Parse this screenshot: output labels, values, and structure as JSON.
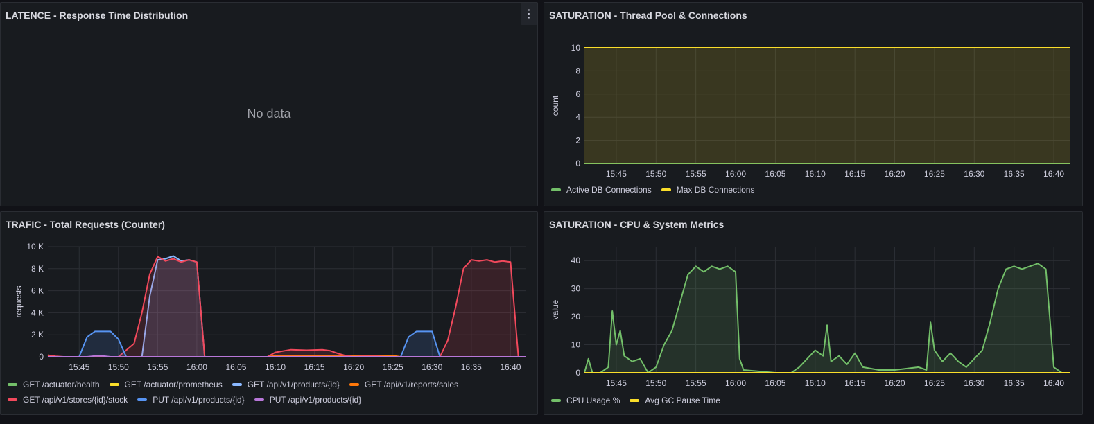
{
  "panels": {
    "latency": {
      "title": "LATENCE - Response Time Distribution",
      "menu_icon": "⋮",
      "no_data": "No data"
    },
    "threads": {
      "title": "SATURATION - Thread Pool & Connections",
      "legend": [
        {
          "label": "Active DB Connections",
          "color": "#73bf69"
        },
        {
          "label": "Max DB Connections",
          "color": "#fade2a"
        }
      ]
    },
    "traffic": {
      "title": "TRAFIC - Total Requests (Counter)",
      "legend": [
        {
          "label": "GET /actuator/health",
          "color": "#73bf69"
        },
        {
          "label": "GET /actuator/prometheus",
          "color": "#fade2a"
        },
        {
          "label": "GET /api/v1/products/{id}",
          "color": "#8ab8ff"
        },
        {
          "label": "GET /api/v1/reports/sales",
          "color": "#ff780a"
        },
        {
          "label": "GET /api/v1/stores/{id}/stock",
          "color": "#f2495c"
        },
        {
          "label": "PUT /api/v1/products/{id}",
          "color": "#5794f2"
        },
        {
          "label": "PUT /api/v1/products/{id}",
          "color": "#b877d9"
        }
      ]
    },
    "cpu": {
      "title": "SATURATION - CPU & System Metrics",
      "legend": [
        {
          "label": "CPU Usage %",
          "color": "#73bf69"
        },
        {
          "label": "Avg GC Pause Time",
          "color": "#fade2a"
        }
      ]
    }
  },
  "chart_data": [
    {
      "id": "threads",
      "type": "area",
      "ylabel": "count",
      "ylim": [
        0,
        10
      ],
      "xlim": [
        "15:41",
        "16:42"
      ],
      "y_ticks": [
        "0",
        "2",
        "4",
        "6",
        "8",
        "10"
      ],
      "x_ticks": [
        "15:45",
        "15:50",
        "15:55",
        "16:00",
        "16:05",
        "16:10",
        "16:15",
        "16:20",
        "16:25",
        "16:30",
        "16:35",
        "16:40"
      ],
      "grid": true,
      "series": [
        {
          "name": "Active DB Connections",
          "color": "#73bf69",
          "x": [
            "15:41",
            "16:42"
          ],
          "values": [
            0,
            0
          ]
        },
        {
          "name": "Max DB Connections",
          "color": "#fade2a",
          "x": [
            "15:41",
            "16:42"
          ],
          "values": [
            10,
            10
          ]
        }
      ]
    },
    {
      "id": "traffic",
      "type": "area",
      "ylabel": "requests",
      "ylim": [
        0,
        10000
      ],
      "xlim": [
        "15:41",
        "16:42"
      ],
      "y_ticks": [
        "0",
        "2 K",
        "4 K",
        "6 K",
        "8 K",
        "10 K"
      ],
      "x_ticks": [
        "15:45",
        "15:50",
        "15:55",
        "16:00",
        "16:05",
        "16:10",
        "16:15",
        "16:20",
        "16:25",
        "16:30",
        "16:35",
        "16:40"
      ],
      "grid": true,
      "series": [
        {
          "name": "GET /actuator/health",
          "color": "#73bf69",
          "x": [
            "15:41",
            "16:42"
          ],
          "values": [
            0,
            0
          ]
        },
        {
          "name": "GET /actuator/prometheus",
          "color": "#fade2a",
          "x": [
            "16:08",
            "16:42"
          ],
          "values": [
            0,
            0
          ]
        },
        {
          "name": "GET /api/v1/products/{id}",
          "color": "#8ab8ff",
          "x": [
            "15:41",
            "15:53",
            "15:54",
            "15:55",
            "15:56",
            "15:57",
            "15:58",
            "15:59",
            "16:00",
            "16:01",
            "16:42"
          ],
          "values": [
            0,
            0,
            5500,
            8800,
            8900,
            9150,
            8700,
            8800,
            8600,
            0,
            0
          ]
        },
        {
          "name": "GET /api/v1/reports/sales",
          "color": "#ff780a",
          "x": [
            "15:41",
            "15:42",
            "15:43",
            "16:09",
            "16:10",
            "16:20",
            "16:21",
            "16:25",
            "16:26",
            "16:42"
          ],
          "values": [
            100,
            0,
            0,
            0,
            100,
            100,
            100,
            100,
            0,
            0
          ]
        },
        {
          "name": "GET /api/v1/stores/{id}/stock",
          "color": "#f2495c",
          "x": [
            "15:41",
            "15:42",
            "15:43",
            "15:50",
            "15:52",
            "15:53",
            "15:54",
            "15:55",
            "15:56",
            "15:57",
            "15:58",
            "15:59",
            "16:00",
            "16:01",
            "16:09",
            "16:10",
            "16:12",
            "16:14",
            "16:16",
            "16:17",
            "16:18",
            "16:19",
            "16:20",
            "16:21",
            "16:23",
            "16:24",
            "16:25",
            "16:26",
            "16:31",
            "16:32",
            "16:33",
            "16:34",
            "16:35",
            "16:36",
            "16:37",
            "16:38",
            "16:39",
            "16:40",
            "16:41",
            "16:42"
          ],
          "values": [
            150,
            50,
            0,
            0,
            1200,
            4000,
            7500,
            9100,
            8700,
            8900,
            8600,
            8800,
            8600,
            0,
            0,
            400,
            650,
            600,
            650,
            550,
            300,
            100,
            0,
            50,
            50,
            0,
            0,
            0,
            0,
            1500,
            4500,
            8000,
            8800,
            8700,
            8800,
            8600,
            8700,
            8600,
            0,
            0
          ]
        },
        {
          "name": "PUT /api/v1/products/{id}",
          "color": "#5794f2",
          "x": [
            "15:41",
            "15:45",
            "15:46",
            "15:47",
            "15:48",
            "15:49",
            "15:50",
            "15:51",
            "16:26",
            "16:27",
            "16:28",
            "16:29",
            "16:30",
            "16:31",
            "16:42"
          ],
          "values": [
            0,
            0,
            1800,
            2300,
            2300,
            2300,
            1600,
            0,
            0,
            1800,
            2300,
            2300,
            2300,
            0,
            0
          ]
        },
        {
          "name": "PUT /api/v1/products/{id}",
          "color": "#b877d9",
          "x": [
            "15:41",
            "15:46",
            "15:47",
            "15:48",
            "15:49",
            "16:08",
            "16:09",
            "16:42"
          ],
          "values": [
            0,
            0,
            80,
            80,
            0,
            0,
            0,
            0
          ]
        }
      ]
    },
    {
      "id": "cpu",
      "type": "area",
      "ylabel": "value",
      "ylim": [
        0,
        45
      ],
      "xlim": [
        "15:41",
        "16:42"
      ],
      "y_ticks": [
        "0",
        "10",
        "20",
        "30",
        "40"
      ],
      "x_ticks": [
        "15:45",
        "15:50",
        "15:55",
        "16:00",
        "16:05",
        "16:10",
        "16:15",
        "16:20",
        "16:25",
        "16:30",
        "16:35",
        "16:40"
      ],
      "grid": true,
      "series": [
        {
          "name": "CPU Usage %",
          "color": "#73bf69",
          "x": [
            "15:41",
            "15:41:30",
            "15:42",
            "15:43",
            "15:44",
            "15:44:30",
            "15:45",
            "15:45:30",
            "15:46",
            "15:47",
            "15:48",
            "15:49",
            "15:50",
            "15:51",
            "15:52",
            "15:53",
            "15:54",
            "15:55",
            "15:56",
            "15:57",
            "15:58",
            "15:59",
            "16:00",
            "16:00:30",
            "16:01",
            "16:05",
            "16:07",
            "16:08",
            "16:09",
            "16:10",
            "16:11",
            "16:11:30",
            "16:12",
            "16:13",
            "16:14",
            "16:15",
            "16:16",
            "16:18",
            "16:20",
            "16:23",
            "16:24",
            "16:24:30",
            "16:25",
            "16:26",
            "16:27",
            "16:28",
            "16:29",
            "16:30",
            "16:31",
            "16:32",
            "16:33",
            "16:34",
            "16:35",
            "16:36",
            "16:37",
            "16:38",
            "16:39",
            "16:40",
            "16:41",
            "16:42"
          ],
          "values": [
            0,
            5,
            0,
            0,
            2,
            22,
            10,
            15,
            6,
            4,
            5,
            0,
            2,
            10,
            15,
            25,
            35,
            38,
            36,
            38,
            37,
            38,
            36,
            5,
            1,
            0,
            0,
            2,
            5,
            8,
            6,
            17,
            4,
            6,
            3,
            7,
            2,
            1,
            1,
            2,
            1,
            18,
            8,
            4,
            7,
            4,
            2,
            5,
            8,
            18,
            30,
            37,
            38,
            37,
            38,
            39,
            37,
            2,
            0,
            0
          ]
        },
        {
          "name": "Avg GC Pause Time",
          "color": "#fade2a",
          "x": [
            "15:41",
            "16:42"
          ],
          "values": [
            0,
            0
          ]
        }
      ]
    }
  ]
}
